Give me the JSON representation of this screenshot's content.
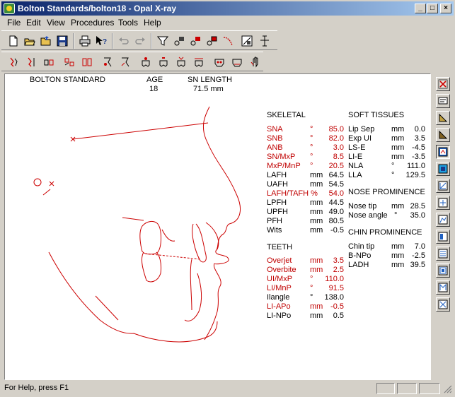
{
  "window": {
    "title": "Bolton Standards/bolton18 - Opal X-ray"
  },
  "menu": [
    "File",
    "Edit",
    "View",
    "Procedures",
    "Tools",
    "Help"
  ],
  "icons": {
    "toolbar1": [
      "new-icon",
      "open-icon",
      "open-folder-icon",
      "save-icon",
      "print-icon",
      "context-help-icon",
      "undo-icon",
      "redo-icon",
      "funnel-icon",
      "point-icon-1",
      "point-icon-2",
      "point-icon-3",
      "curve-icon",
      "digitize-icon",
      "measure-icon"
    ],
    "toolbar2": [
      "profile-icon-1",
      "profile-icon-2",
      "profile-icon-3",
      "teeth-icon-1",
      "teeth-icon-2",
      "face-icon-1",
      "face-icon-2",
      "tooth-icon-1",
      "tooth-icon-2",
      "tooth-icon-3",
      "tooth-icon-4",
      "skull-icon-1",
      "skull-icon-2",
      "hand-icon"
    ],
    "right_toolbar": [
      "delete-icon",
      "display-icon",
      "triangle-icon",
      "triangle-alt-icon",
      "screen-icon",
      "screen-blue-icon",
      "view-icon-1",
      "view-icon-2",
      "view-icon-3",
      "view-icon-4",
      "view-icon-5",
      "view-icon-6",
      "view-icon-7",
      "view-icon-8"
    ]
  },
  "header": {
    "standard": "BOLTON STANDARD",
    "age_label": "AGE",
    "age_value": "18",
    "sn_label": "SN LENGTH",
    "sn_value": "71.5 mm"
  },
  "skeletal": {
    "title": "SKELETAL",
    "rows": [
      {
        "label": "SNA",
        "unit": "°",
        "value": "85.0",
        "red": true
      },
      {
        "label": "SNB",
        "unit": "°",
        "value": "82.0",
        "red": true
      },
      {
        "label": "ANB",
        "unit": "°",
        "value": "3.0",
        "red": true
      },
      {
        "label": "SN/MxP",
        "unit": "°",
        "value": "8.5",
        "red": true
      },
      {
        "label": "MxP/MnP",
        "unit": "°",
        "value": "20.5",
        "red": true
      },
      {
        "label": "LAFH",
        "unit": "mm",
        "value": "64.5",
        "red": false
      },
      {
        "label": "UAFH",
        "unit": "mm",
        "value": "54.5",
        "red": false
      },
      {
        "label": "LAFH/TAFH %",
        "unit": "",
        "value": "54.0",
        "red": true
      },
      {
        "label": "LPFH",
        "unit": "mm",
        "value": "44.5",
        "red": false
      },
      {
        "label": "UPFH",
        "unit": "mm",
        "value": "49.0",
        "red": false
      },
      {
        "label": "PFH",
        "unit": "mm",
        "value": "80.5",
        "red": false
      },
      {
        "label": "Wits",
        "unit": "mm",
        "value": "-0.5",
        "red": false
      }
    ]
  },
  "teeth": {
    "title": "TEETH",
    "rows": [
      {
        "label": "Overjet",
        "unit": "mm",
        "value": "3.5",
        "red": true
      },
      {
        "label": "Overbite",
        "unit": "mm",
        "value": "2.5",
        "red": true
      },
      {
        "label": "UI/MxP",
        "unit": "°",
        "value": "110.0",
        "red": true
      },
      {
        "label": "LI/MnP",
        "unit": "°",
        "value": "91.5",
        "red": true
      },
      {
        "label": "Ilangle",
        "unit": "°",
        "value": "138.0",
        "red": false
      },
      {
        "label": "LI-APo",
        "unit": "mm",
        "value": "-0.5",
        "red": true
      },
      {
        "label": "LI-NPo",
        "unit": "mm",
        "value": "0.5",
        "red": false
      }
    ]
  },
  "soft_tissues": {
    "title": "SOFT TISSUES",
    "rows": [
      {
        "label": "Lip Sep",
        "unit": "mm",
        "value": "0.0"
      },
      {
        "label": "Exp UI",
        "unit": "mm",
        "value": "3.5"
      },
      {
        "label": "LS-E",
        "unit": "mm",
        "value": "-4.5"
      },
      {
        "label": "LI-E",
        "unit": "mm",
        "value": "-3.5"
      },
      {
        "label": "NLA",
        "unit": "°",
        "value": "111.0"
      },
      {
        "label": "LLA",
        "unit": "°",
        "value": "129.5"
      }
    ]
  },
  "nose": {
    "title": "NOSE PROMINENCE",
    "rows": [
      {
        "label": "Nose tip",
        "unit": "mm",
        "value": "28.5"
      },
      {
        "label": "Nose angle",
        "unit": "°",
        "value": "35.0"
      }
    ]
  },
  "chin": {
    "title": "CHIN PROMINENCE",
    "rows": [
      {
        "label": "Chin tip",
        "unit": "mm",
        "value": "7.0"
      },
      {
        "label": "B-NPo",
        "unit": "mm",
        "value": "-2.5"
      },
      {
        "label": "LADH",
        "unit": "mm",
        "value": "39.5"
      }
    ]
  },
  "status": {
    "text": "For Help, press F1"
  },
  "colors": {
    "trace": "#cc0000",
    "highlight_text": "#c00000",
    "titlebar_start": "#0a246a",
    "titlebar_end": "#a6caf0"
  }
}
